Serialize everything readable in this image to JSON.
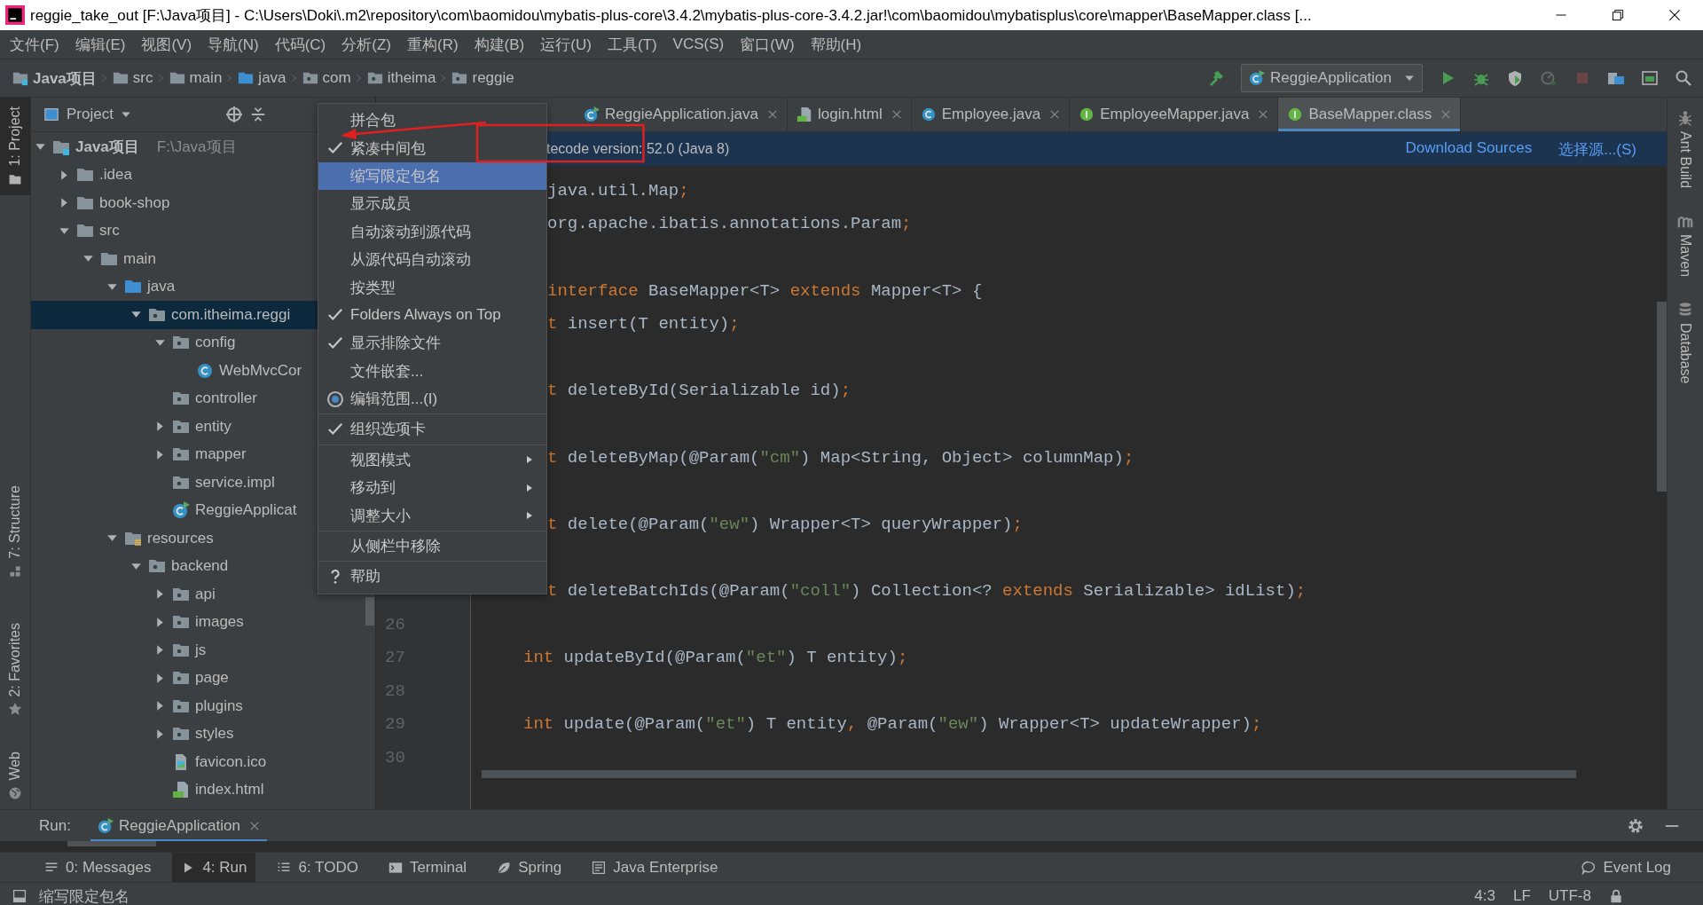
{
  "window": {
    "title": "reggie_take_out [F:\\Java项目] - C:\\Users\\Doki\\.m2\\repository\\com\\baomidou\\mybatis-plus-core\\3.4.2\\mybatis-plus-core-3.4.2.jar!\\com\\baomidou\\mybatisplus\\core\\mapper\\BaseMapper.class [..."
  },
  "menu_bar": [
    "文件(F)",
    "编辑(E)",
    "视图(V)",
    "导航(N)",
    "代码(C)",
    "分析(Z)",
    "重构(R)",
    "构建(B)",
    "运行(U)",
    "工具(T)",
    "VCS(S)",
    "窗口(W)",
    "帮助(H)"
  ],
  "breadcrumbs": [
    {
      "label": "Java项目",
      "kind": "module"
    },
    {
      "label": "src",
      "kind": "folder"
    },
    {
      "label": "main",
      "kind": "folder"
    },
    {
      "label": "java",
      "kind": "source"
    },
    {
      "label": "com",
      "kind": "package"
    },
    {
      "label": "itheima",
      "kind": "package"
    },
    {
      "label": "reggie",
      "kind": "package"
    }
  ],
  "run_configuration": {
    "label": "ReggieApplication"
  },
  "toolbar": [
    {
      "kind": "build",
      "disabled": false
    },
    {
      "kind": "run",
      "disabled": false
    },
    {
      "kind": "debug",
      "disabled": false
    },
    {
      "kind": "coverage",
      "disabled": false
    },
    {
      "kind": "profile",
      "disabled": true
    },
    {
      "kind": "stop",
      "disabled": true
    },
    {
      "kind": "structure",
      "disabled": false
    },
    {
      "kind": "layout",
      "disabled": false
    },
    {
      "kind": "search",
      "disabled": false
    }
  ],
  "left_tool_strip": [
    {
      "label": "1: Project",
      "kind": "project",
      "selected": true
    },
    {
      "label": "7: Structure",
      "kind": "structure",
      "selected": false
    },
    {
      "label": "2: Favorites",
      "kind": "favorites",
      "selected": false
    },
    {
      "label": "Web",
      "kind": "web",
      "selected": false
    }
  ],
  "project_panel": {
    "title": "Project",
    "tree": [
      {
        "label": "Java项目",
        "path": "F:\\Java项目",
        "kind": "module",
        "expanded": true,
        "selected": false,
        "children": [
          {
            "label": ".idea",
            "kind": "folder",
            "expanded": false,
            "selected": false
          },
          {
            "label": "book-shop",
            "kind": "folder",
            "expanded": false,
            "selected": false
          },
          {
            "label": "src",
            "kind": "folder",
            "expanded": true,
            "selected": false,
            "children": [
              {
                "label": "main",
                "kind": "folder",
                "expanded": true,
                "selected": false,
                "children": [
                  {
                    "label": "java",
                    "kind": "source",
                    "expanded": true,
                    "selected": false,
                    "children": [
                      {
                        "label": "com.itheima.reggi",
                        "kind": "package",
                        "expanded": true,
                        "selected": true,
                        "children": [
                          {
                            "label": "config",
                            "kind": "package",
                            "expanded": true,
                            "selected": false,
                            "children": [
                              {
                                "label": "WebMvcCor",
                                "kind": "class",
                                "selected": false
                              }
                            ]
                          },
                          {
                            "label": "controller",
                            "kind": "package",
                            "selected": false
                          },
                          {
                            "label": "entity",
                            "kind": "package",
                            "expanded": false,
                            "selected": false
                          },
                          {
                            "label": "mapper",
                            "kind": "package",
                            "expanded": false,
                            "selected": false
                          },
                          {
                            "label": "service.impl",
                            "kind": "package",
                            "selected": false
                          },
                          {
                            "label": "ReggieApplicat",
                            "kind": "app",
                            "selected": false
                          }
                        ]
                      }
                    ]
                  },
                  {
                    "label": "resources",
                    "kind": "resources",
                    "expanded": true,
                    "selected": false,
                    "children": [
                      {
                        "label": "backend",
                        "kind": "package",
                        "expanded": true,
                        "selected": false,
                        "children": [
                          {
                            "label": "api",
                            "kind": "package",
                            "expanded": false,
                            "selected": false
                          },
                          {
                            "label": "images",
                            "kind": "package",
                            "expanded": false,
                            "selected": false
                          },
                          {
                            "label": "js",
                            "kind": "package",
                            "expanded": false,
                            "selected": false
                          },
                          {
                            "label": "page",
                            "kind": "package",
                            "expanded": false,
                            "selected": false
                          },
                          {
                            "label": "plugins",
                            "kind": "package",
                            "expanded": false,
                            "selected": false
                          },
                          {
                            "label": "styles",
                            "kind": "package",
                            "expanded": false,
                            "selected": false
                          },
                          {
                            "label": "favicon.ico",
                            "kind": "image",
                            "selected": false
                          },
                          {
                            "label": "index.html",
                            "kind": "html",
                            "selected": false
                          }
                        ]
                      }
                    ]
                  }
                ]
              }
            ]
          }
        ]
      }
    ]
  },
  "editor": {
    "tabs": [
      {
        "label": "ReggieApplication.java",
        "kind": "app",
        "selected": false
      },
      {
        "label": "login.html",
        "kind": "html",
        "selected": false
      },
      {
        "label": "Employee.java",
        "kind": "class",
        "selected": false
      },
      {
        "label": "EmployeeMapper.java",
        "kind": "interface",
        "selected": false
      },
      {
        "label": "BaseMapper.class",
        "kind": "interface",
        "selected": true
      }
    ],
    "banner": {
      "text": "tecode version: 52.0 (Java 8)",
      "links": [
        "Download Sources",
        "选择源...(S)"
      ]
    },
    "lines": [
      {
        "kind": "clipped",
        "tokens": [
          {
            "kind": "plain",
            "text": "java.util.Map"
          },
          {
            "kind": "kw",
            "text": ";"
          }
        ]
      },
      {
        "kind": "clipped",
        "tokens": [
          {
            "kind": "plain",
            "text": "org.apache.ibatis.annotations.Param"
          },
          {
            "kind": "kw",
            "text": ";"
          }
        ]
      },
      {
        "kind": "blank"
      },
      {
        "kind": "clipped",
        "tokens": [
          {
            "kind": "kw",
            "text": "interface"
          },
          {
            "kind": "plain",
            "text": " BaseMapper<T> "
          },
          {
            "kind": "kw",
            "text": "extends"
          },
          {
            "kind": "plain",
            "text": " Mapper<T> {"
          }
        ]
      },
      {
        "kind": "clipped",
        "tokens": [
          {
            "kind": "kw",
            "text": "t"
          },
          {
            "kind": "plain",
            "text": " insert(T entity)"
          },
          {
            "kind": "kw",
            "text": ";"
          }
        ]
      },
      {
        "kind": "blank"
      },
      {
        "kind": "clipped",
        "tokens": [
          {
            "kind": "kw",
            "text": "t"
          },
          {
            "kind": "plain",
            "text": " deleteById(Serializable id)"
          },
          {
            "kind": "kw",
            "text": ";"
          }
        ]
      },
      {
        "kind": "blank"
      },
      {
        "kind": "clipped",
        "tokens": [
          {
            "kind": "kw",
            "text": "t"
          },
          {
            "kind": "plain",
            "text": " deleteByMap(@Param("
          },
          {
            "kind": "str",
            "text": "\"cm\""
          },
          {
            "kind": "plain",
            "text": ") Map<String, Object> columnMap)"
          },
          {
            "kind": "kw",
            "text": ";"
          }
        ]
      },
      {
        "kind": "blank"
      },
      {
        "kind": "clipped",
        "tokens": [
          {
            "kind": "kw",
            "text": "t"
          },
          {
            "kind": "plain",
            "text": " delete(@Param("
          },
          {
            "kind": "str",
            "text": "\"ew\""
          },
          {
            "kind": "plain",
            "text": ") Wrapper<T> queryWrapper)"
          },
          {
            "kind": "kw",
            "text": ";"
          }
        ]
      },
      {
        "kind": "blank"
      },
      {
        "kind": "clipped",
        "tokens": [
          {
            "kind": "kw",
            "text": "t"
          },
          {
            "kind": "plain",
            "text": " deleteBatchIds(@Param("
          },
          {
            "kind": "str",
            "text": "\"coll\""
          },
          {
            "kind": "plain",
            "text": ") Collection<? "
          },
          {
            "kind": "kw",
            "text": "extends"
          },
          {
            "kind": "plain",
            "text": " Serializable> idList)"
          },
          {
            "kind": "kw",
            "text": ";"
          }
        ]
      },
      {
        "kind": "blank",
        "number": "26"
      },
      {
        "kind": "code",
        "number": "27",
        "tokens": [
          {
            "kind": "kw",
            "text": "int"
          },
          {
            "kind": "plain",
            "text": " updateById(@Param("
          },
          {
            "kind": "str",
            "text": "\"et\""
          },
          {
            "kind": "plain",
            "text": ") T entity)"
          },
          {
            "kind": "kw",
            "text": ";"
          }
        ]
      },
      {
        "kind": "blank",
        "number": "28"
      },
      {
        "kind": "code",
        "number": "29",
        "tokens": [
          {
            "kind": "kw",
            "text": "int"
          },
          {
            "kind": "plain",
            "text": " update(@Param("
          },
          {
            "kind": "str",
            "text": "\"et\""
          },
          {
            "kind": "plain",
            "text": ") T entity"
          },
          {
            "kind": "kw",
            "text": ","
          },
          {
            "kind": "plain",
            "text": " @Param("
          },
          {
            "kind": "str",
            "text": "\"ew\""
          },
          {
            "kind": "plain",
            "text": ") Wrapper<T> updateWrapper)"
          },
          {
            "kind": "kw",
            "text": ";"
          }
        ]
      },
      {
        "kind": "blank",
        "number": "30"
      }
    ]
  },
  "right_tool_strip": [
    {
      "label": "Ant Build",
      "kind": "ant"
    },
    {
      "label": "Maven",
      "kind": "maven"
    },
    {
      "label": "Database",
      "kind": "database"
    }
  ],
  "context_menu": {
    "groups": [
      [
        {
          "label": "拼合包",
          "kind": "toggle",
          "checked": false,
          "selected": false
        },
        {
          "label": "紧凑中间包",
          "kind": "toggle",
          "checked": true,
          "selected": false
        },
        {
          "label": "缩写限定包名",
          "kind": "toggle",
          "checked": false,
          "selected": true
        },
        {
          "label": "显示成员",
          "kind": "toggle",
          "checked": false,
          "selected": false
        },
        {
          "label": "自动滚动到源代码",
          "kind": "toggle",
          "checked": false,
          "selected": false
        },
        {
          "label": "从源代码自动滚动",
          "kind": "toggle",
          "checked": false,
          "selected": false
        },
        {
          "label": "按类型",
          "kind": "toggle",
          "checked": false,
          "selected": false
        },
        {
          "label": "Folders Always on Top",
          "kind": "toggle",
          "checked": true,
          "selected": false
        },
        {
          "label": "显示排除文件",
          "kind": "toggle",
          "checked": true,
          "selected": false
        },
        {
          "label": "文件嵌套...",
          "kind": "action",
          "selected": false
        },
        {
          "label": "编辑范围...(I)",
          "kind": "scope",
          "selected": false
        }
      ],
      [
        {
          "label": "组织选项卡",
          "kind": "toggle",
          "checked": true,
          "selected": false
        }
      ],
      [
        {
          "label": "视图模式",
          "kind": "submenu",
          "selected": false
        },
        {
          "label": "移动到",
          "kind": "submenu",
          "selected": false
        },
        {
          "label": "调整大小",
          "kind": "submenu",
          "selected": false
        }
      ],
      [
        {
          "label": "从侧栏中移除",
          "kind": "action",
          "selected": false
        }
      ],
      [
        {
          "label": "帮助",
          "kind": "help",
          "selected": false
        }
      ]
    ]
  },
  "run_panel": {
    "title": "Run:",
    "tabs": [
      {
        "label": "ReggieApplication",
        "selected": true
      }
    ]
  },
  "tool_windows": [
    {
      "label": "0: Messages",
      "kind": "messages",
      "selected": false
    },
    {
      "label": "4: Run",
      "kind": "run",
      "selected": true
    },
    {
      "label": "6: TODO",
      "kind": "todo",
      "selected": false
    },
    {
      "label": "Terminal",
      "kind": "terminal",
      "selected": false
    },
    {
      "label": "Spring",
      "kind": "spring",
      "selected": false
    },
    {
      "label": "Java Enterprise",
      "kind": "enterprise",
      "selected": false
    }
  ],
  "event_log": "Event Log",
  "status_bar": {
    "message": "缩写限定包名",
    "items": [
      "4:3",
      "LF",
      "UTF-8"
    ]
  }
}
